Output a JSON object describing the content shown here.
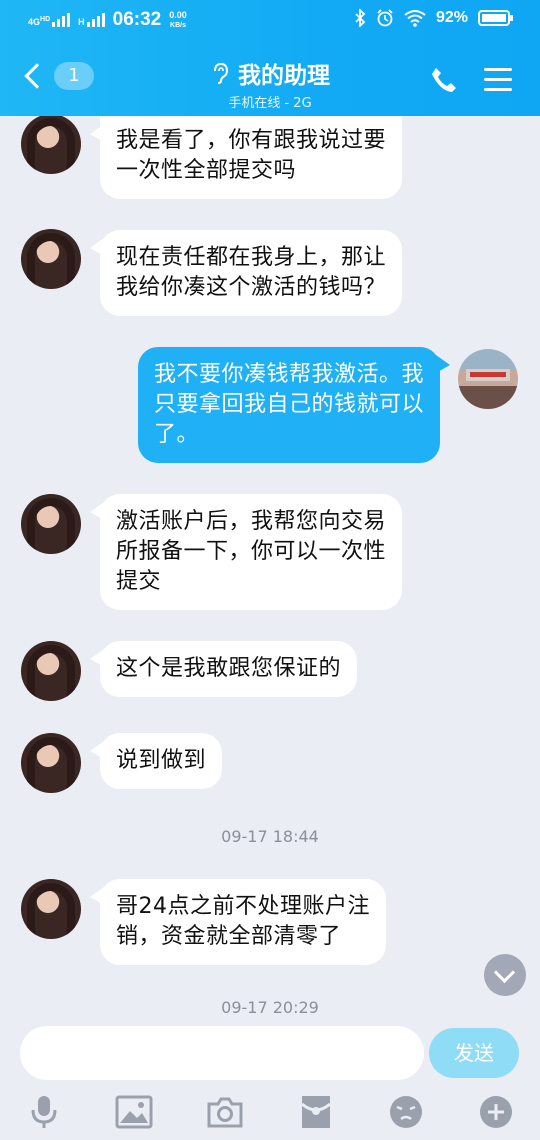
{
  "status_bar": {
    "network_type": "4G",
    "network_sub": "HD",
    "h_label": "H",
    "time": "06:32",
    "speed_value": "0.00",
    "speed_unit": "KB/s",
    "battery_percent": "92%"
  },
  "header": {
    "back_count": "1",
    "title": "我的助理",
    "subtitle": "手机在线 - 2G"
  },
  "messages": [
    {
      "side": "in",
      "text_lines": [
        "我是看了，你有跟我说过要",
        "一次性全部提交吗"
      ]
    },
    {
      "side": "in",
      "text_lines": [
        "现在责任都在我身上，那让",
        "我给你凑这个激活的钱吗？"
      ]
    },
    {
      "side": "out",
      "text_lines": [
        "我不要你凑钱帮我激活。我",
        "只要拿回我自己的钱就可以",
        "了。"
      ]
    },
    {
      "side": "in",
      "text_lines": [
        "激活账户后，我帮您向交易",
        "所报备一下，你可以一次性",
        "提交"
      ]
    },
    {
      "side": "in",
      "text_lines": [
        "这个是我敢跟您保证的"
      ]
    },
    {
      "side": "in",
      "text_lines": [
        "说到做到"
      ]
    },
    {
      "side": "in",
      "text_lines": [
        "哥24点之前不处理账户注",
        "销，资金就全部清零了"
      ]
    }
  ],
  "timestamps": [
    "09-17 18:44",
    "09-17 20:29"
  ],
  "composer": {
    "placeholder": "",
    "send_label": "发送"
  },
  "icons": {
    "tools": [
      "microphone-icon",
      "image-icon",
      "camera-icon",
      "red-packet-icon",
      "emoji-icon",
      "plus-icon"
    ]
  },
  "colors": {
    "header_blue": "#12aaf4",
    "outgoing_bubble": "#1fb0f5",
    "send_button": "#8fdcf7",
    "background": "#eaedf4"
  }
}
